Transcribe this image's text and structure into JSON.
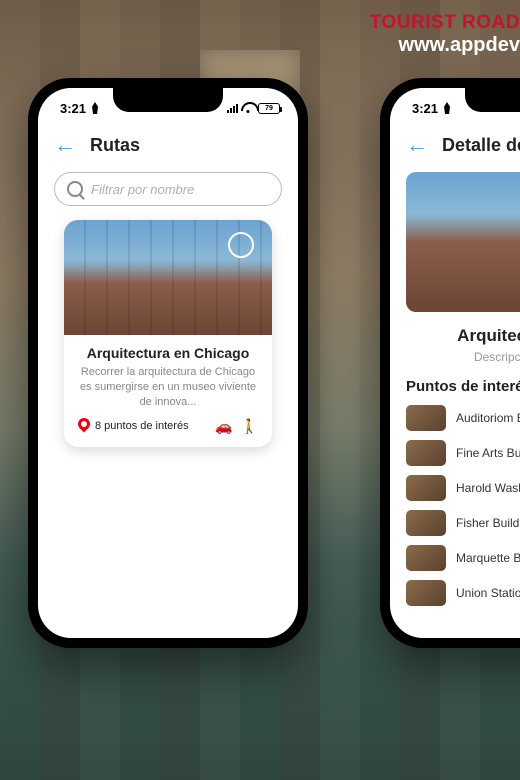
{
  "banner": {
    "line1": "TOURIST ROAD",
    "line2": "www.appdev"
  },
  "statusbar": {
    "time": "3:21",
    "battery": "79"
  },
  "phone1": {
    "header": {
      "title": "Rutas"
    },
    "search": {
      "placeholder": "Filtrar por nombre"
    },
    "card": {
      "title": "Arquitectura en Chicago",
      "desc": "Recorrer la arquitectura de Chicago es sumergirse en un museo viviente de innova...",
      "poi_count": "8 puntos de interés"
    }
  },
  "phone2": {
    "header": {
      "title": "Detalle de ruta"
    },
    "title": "Arquitectura en",
    "desc": "Descripción no di",
    "section": "Puntos de interés",
    "poi": [
      {
        "name": "Auditoriom Building"
      },
      {
        "name": "Fine Arts Building"
      },
      {
        "name": "Harold Washington Li"
      },
      {
        "name": "Fisher Building"
      },
      {
        "name": "Marquette Building"
      },
      {
        "name": "Union Station"
      }
    ]
  }
}
